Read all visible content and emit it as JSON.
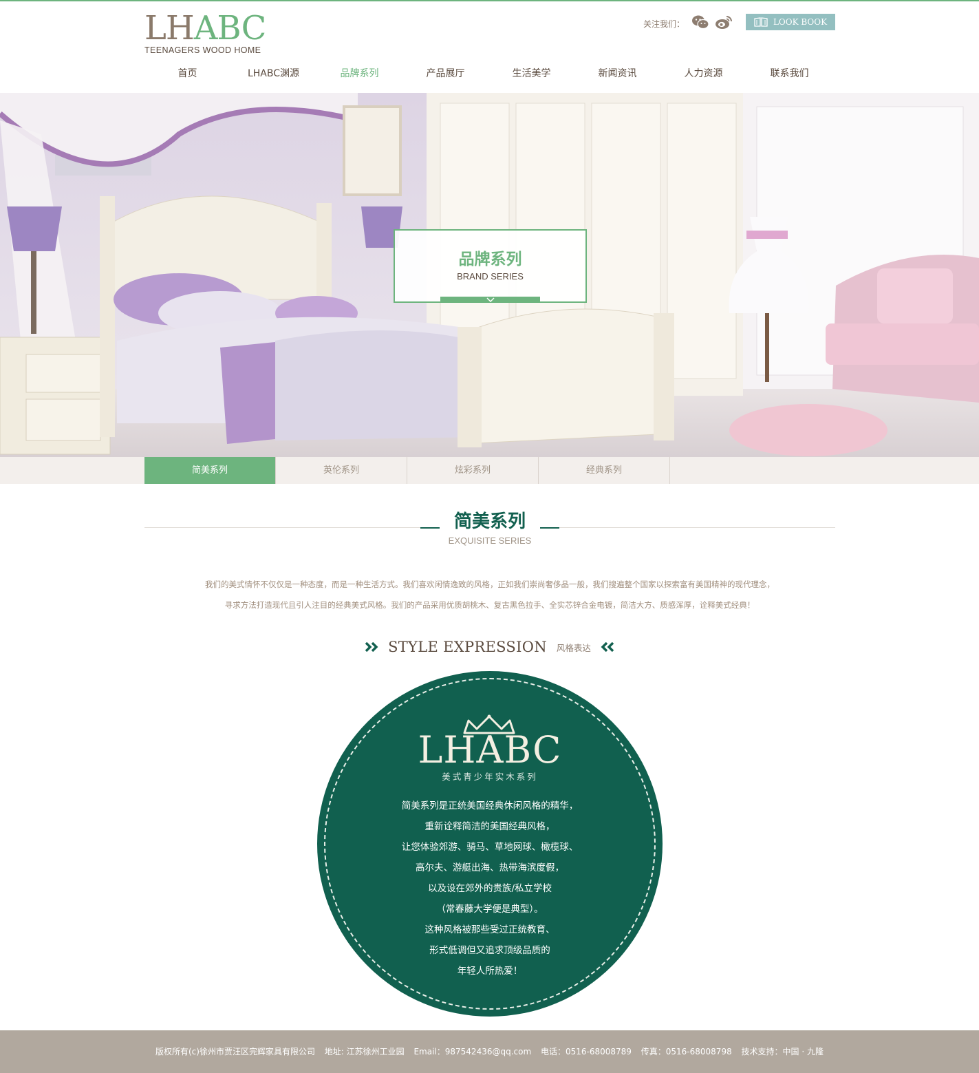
{
  "header": {
    "logo_main_1": "LH",
    "logo_main_2": "ABC",
    "logo_sub": "TEENAGERS WOOD HOME",
    "follow_label": "关注我们：",
    "wechat_icon": "wechat-icon",
    "weibo_icon": "weibo-icon",
    "lookbook_label": "LOOK BOOK"
  },
  "nav": {
    "items": [
      {
        "label": "首页"
      },
      {
        "label": "LHABC渊源"
      },
      {
        "label": "品牌系列"
      },
      {
        "label": "产品展厅"
      },
      {
        "label": "生活美学"
      },
      {
        "label": "新闻资讯"
      },
      {
        "label": "人力资源"
      },
      {
        "label": "联系我们"
      }
    ],
    "active_index": 2
  },
  "hero": {
    "title": "品牌系列",
    "subtitle": "BRAND SERIES"
  },
  "tabs": {
    "items": [
      {
        "label": "简美系列"
      },
      {
        "label": "英伦系列"
      },
      {
        "label": "炫彩系列"
      },
      {
        "label": "经典系列"
      }
    ],
    "active_index": 0
  },
  "section": {
    "title": "简美系列",
    "subtitle": "EXQUISITE SERIES",
    "intro_line_1": "我们的美式情怀不仅仅是一种态度，而是一种生活方式。我们喜欢闲情逸致的风格，正如我们崇尚奢侈品一般，我们搜遍整个国家以探索富有美国精神的现代理念，",
    "intro_line_2": "寻求方法打造现代且引人注目的经典美式风格。我们的产品采用优质胡桃木、复古黑色拉手、全实芯锌合金电镀，简洁大方、质感浑厚，诠释美式经典！"
  },
  "style_expression": {
    "title": "STYLE EXPRESSION",
    "title_cn": "风格表达"
  },
  "badge": {
    "logo": "LHABC",
    "tagline": "美式青少年实木系列",
    "lines": [
      "简美系列是正统美国经典休闲风格的精华，",
      "重新诠释简洁的美国经典风格，",
      "让您体验郊游、骑马、草地网球、橄榄球、",
      "高尔夫、游艇出海、热带海滨度假，",
      "以及设在郊外的贵族/私立学校",
      "（常春藤大学便是典型）。",
      "这种风格被那些受过正统教育、",
      "形式低调但又追求顶级品质的",
      "年轻人所热爱！"
    ]
  },
  "footer": {
    "copyright": "版权所有(c)徐州市贾汪区完辉家具有限公司",
    "address": "地址: 江苏徐州工业园",
    "email": "Email：987542436@qq.com",
    "phone": "电话：0516-68008789",
    "fax": "传真：0516-68008798",
    "support": "技术支持：中国 · 九隆"
  },
  "colors": {
    "accent_green": "#6db47e",
    "dark_green": "#12604f",
    "footer_bg": "#b1a89e",
    "lookbook_bg": "#93bfc0"
  }
}
